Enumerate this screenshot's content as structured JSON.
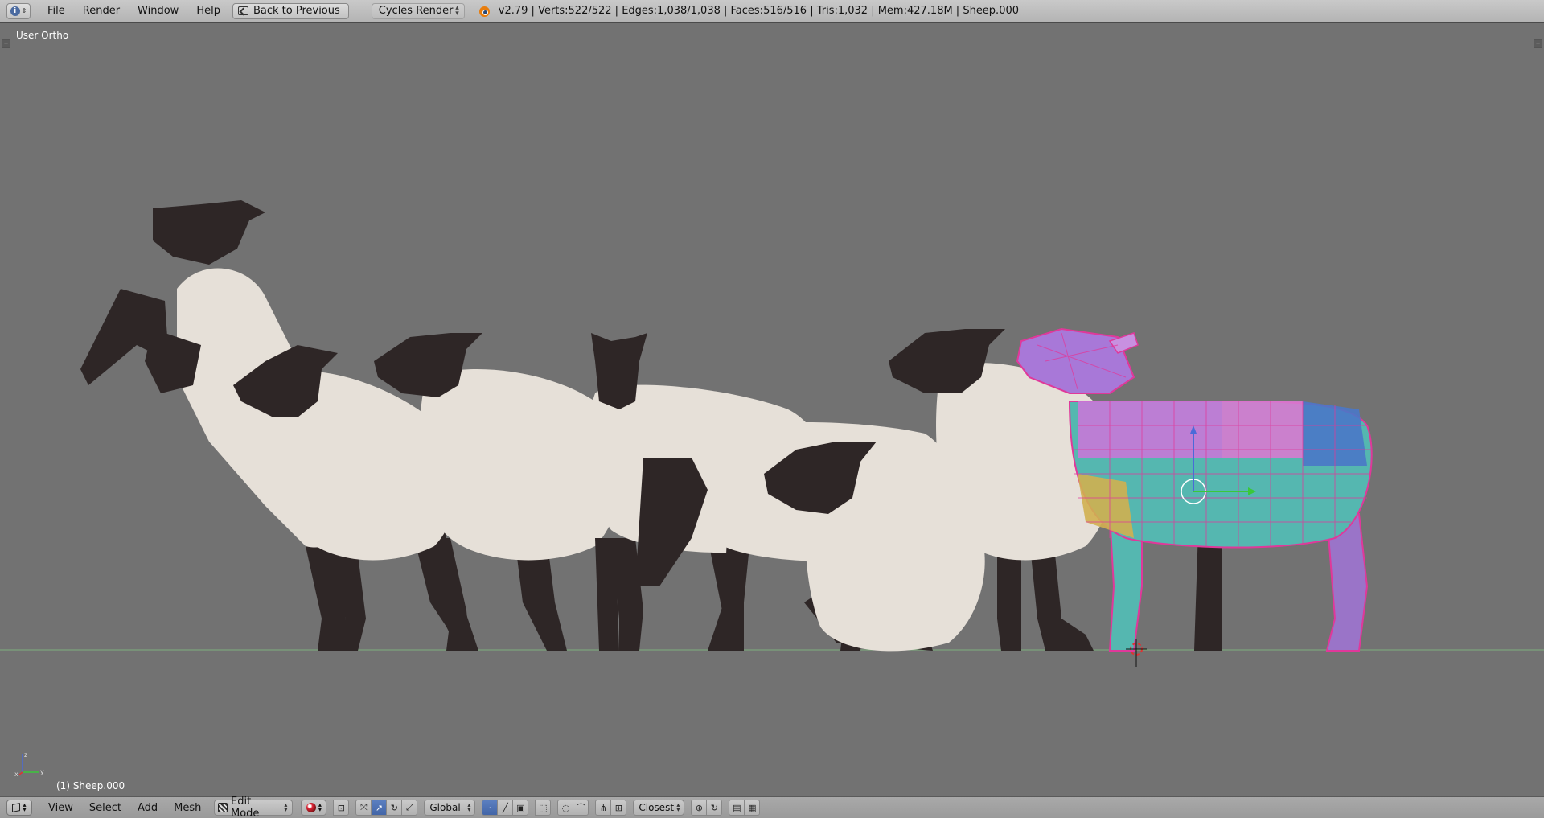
{
  "top_header": {
    "menu": [
      "File",
      "Render",
      "Window",
      "Help"
    ],
    "back_label": "Back to Previous",
    "render_engine": "Cycles Render",
    "stats": "v2.79 | Verts:522/522 | Edges:1,038/1,038 | Faces:516/516 | Tris:1,032 | Mem:427.18M | Sheep.000"
  },
  "viewport": {
    "view_label": "User Ortho",
    "object_label": "(1) Sheep.000",
    "axis_labels": {
      "x": "x",
      "y": "y",
      "z": "z"
    },
    "colors": {
      "background": "#727272",
      "wool": "#e6e0d8",
      "head_legs": "#2e2626",
      "selected_wire": "#e0389a",
      "ground_line": "#7fb07f"
    }
  },
  "bottom_header": {
    "menu": [
      "View",
      "Select",
      "Add",
      "Mesh"
    ],
    "mode": "Edit Mode",
    "orientation": "Global",
    "snap_target": "Closest"
  }
}
